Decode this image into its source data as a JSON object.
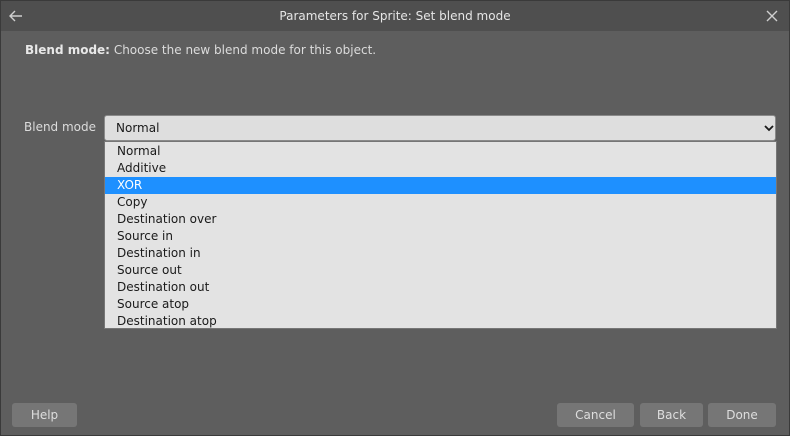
{
  "dialog": {
    "title": "Parameters for Sprite: Set blend mode",
    "back_icon": "arrow-left-icon",
    "close_icon": "close-icon"
  },
  "description": {
    "label": "Blend mode:",
    "text": "Choose the new blend mode for this object."
  },
  "field": {
    "label": "Blend mode",
    "value": "Normal",
    "chevron_icon": "chevron-down-icon"
  },
  "dropdown": {
    "highlighted": "XOR",
    "options": [
      "Normal",
      "Additive",
      "XOR",
      "Copy",
      "Destination over",
      "Source in",
      "Destination in",
      "Source out",
      "Destination out",
      "Source atop",
      "Destination atop"
    ]
  },
  "buttons": {
    "help": "Help",
    "cancel": "Cancel",
    "back": "Back",
    "done": "Done"
  },
  "colors": {
    "dialog_bg": "#5e5e5e",
    "titlebar_bg": "#4f4f4f",
    "highlight": "#1e90ff",
    "button_bg": "#767676"
  }
}
